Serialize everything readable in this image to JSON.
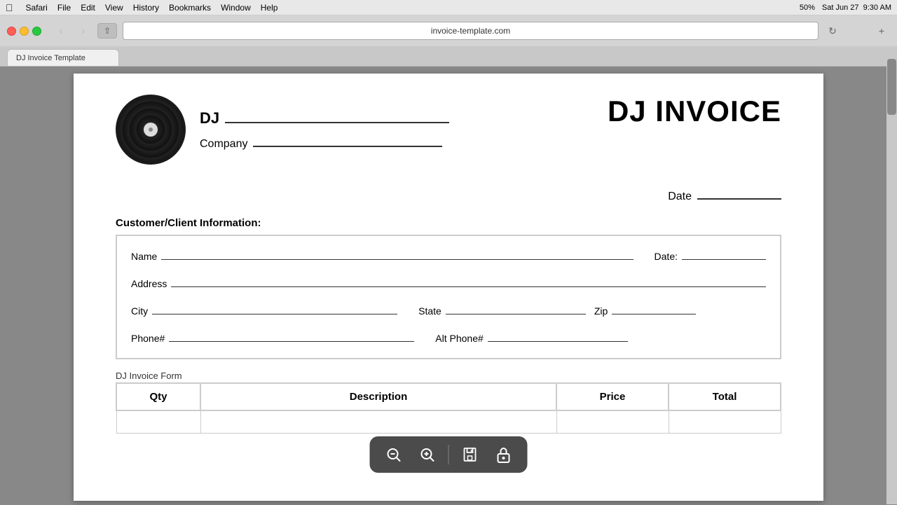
{
  "menubar": {
    "items": [
      "Safari",
      "File",
      "Edit",
      "View",
      "History",
      "Bookmarks",
      "Window",
      "Help"
    ],
    "right": [
      "50%",
      "Sat Jun 27",
      "9:30 AM"
    ]
  },
  "browser": {
    "url": "invoice-template.com",
    "tab_title": "DJ Invoice Template"
  },
  "invoice": {
    "title": "DJ INVOICE",
    "dj_label": "DJ",
    "company_label": "Company",
    "date_label": "Date",
    "customer_section_label": "Customer/Client Information:",
    "fields": {
      "name_label": "Name",
      "date_label": "Date:",
      "address_label": "Address",
      "city_label": "City",
      "state_label": "State",
      "zip_label": "Zip",
      "phone_label": "Phone#",
      "alt_phone_label": "Alt Phone#"
    },
    "form_section_label": "DJ Invoice Form",
    "table_headers": [
      "Qty",
      "Description",
      "Price",
      "Total"
    ]
  },
  "pdf_toolbar": {
    "zoom_out_label": "zoom-out",
    "zoom_in_label": "zoom-in",
    "save_label": "save",
    "lock_label": "lock"
  }
}
